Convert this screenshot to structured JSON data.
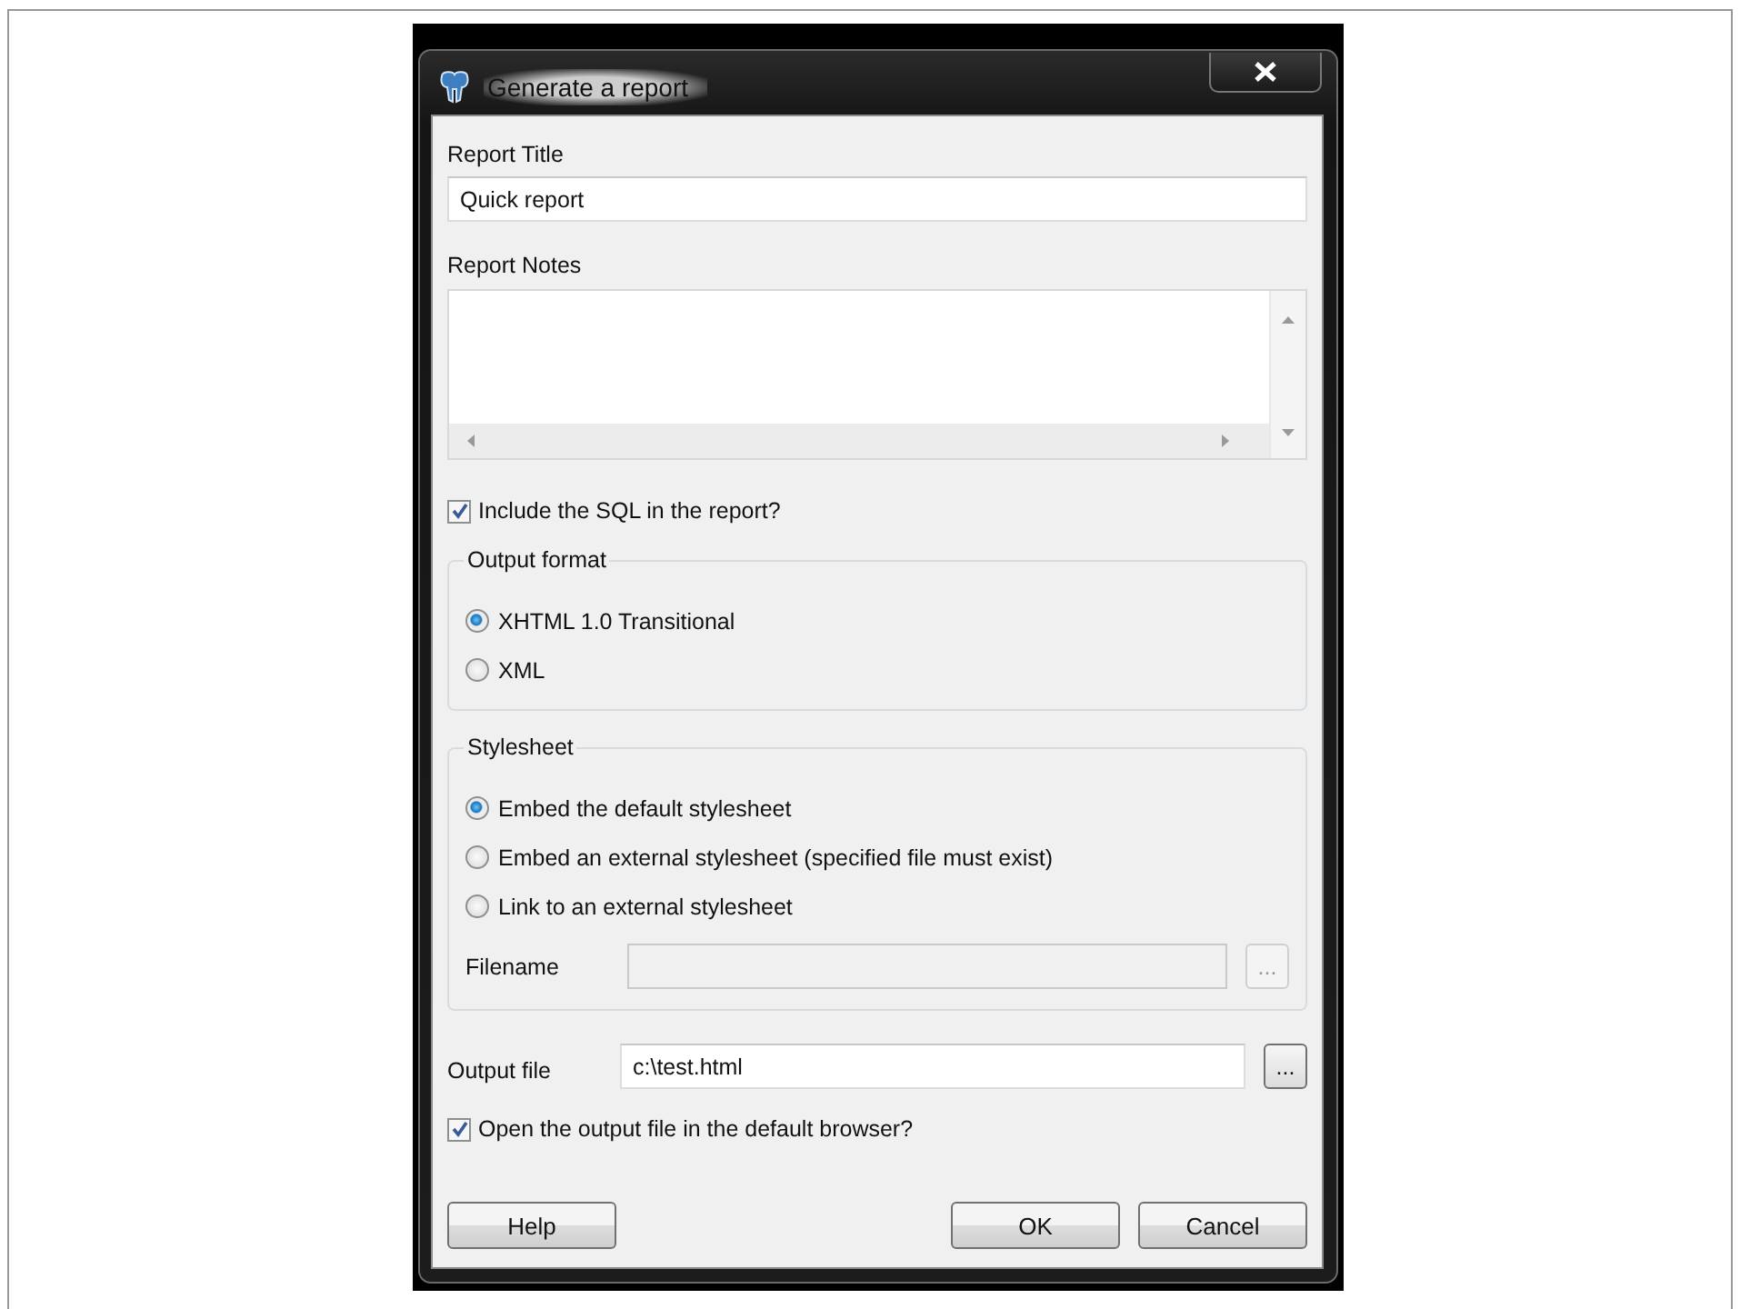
{
  "window": {
    "title": "Generate a report"
  },
  "report_title": {
    "label": "Report Title",
    "value": "Quick report"
  },
  "report_notes": {
    "label": "Report Notes"
  },
  "include_sql": {
    "label": "Include the SQL in the report?",
    "checked": true
  },
  "output_format": {
    "title": "Output format",
    "options": [
      {
        "label": "XHTML 1.0 Transitional",
        "selected": true
      },
      {
        "label": "XML",
        "selected": false
      }
    ]
  },
  "stylesheet": {
    "title": "Stylesheet",
    "options": [
      {
        "label": "Embed the default stylesheet",
        "selected": true
      },
      {
        "label": "Embed an external stylesheet (specified file must exist)",
        "selected": false
      },
      {
        "label": "Link to an external stylesheet",
        "selected": false
      }
    ],
    "filename": {
      "label": "Filename",
      "disabled": true,
      "browse": "..."
    }
  },
  "output_file": {
    "label": "Output file",
    "value": "c:\\test.html",
    "browse": "..."
  },
  "open_browser": {
    "label": "Open the output file in the default browser?",
    "checked": true
  },
  "buttons_left": [
    "Help"
  ],
  "buttons_right": [
    "OK",
    "Cancel"
  ]
}
